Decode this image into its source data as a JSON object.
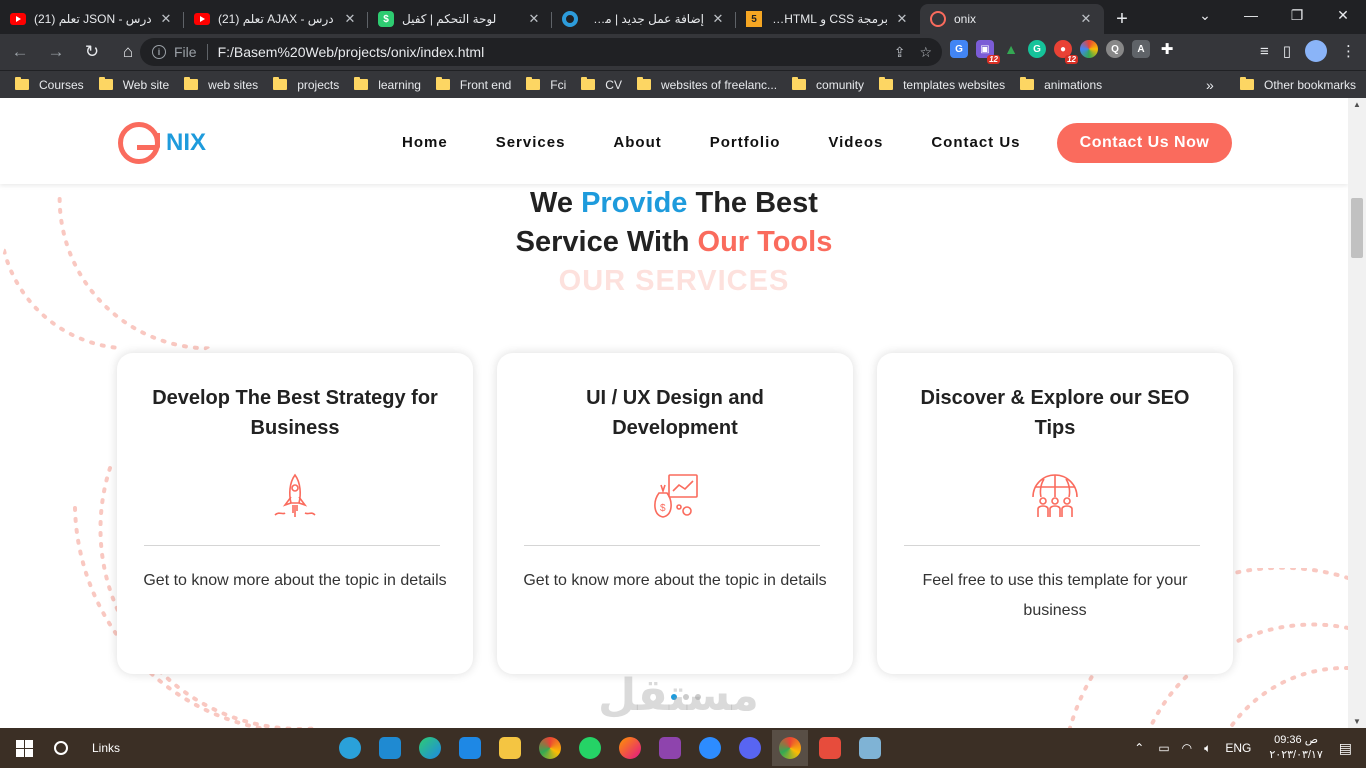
{
  "browser": {
    "tabs": [
      {
        "title": "درس - JSON تعلم (21)",
        "fav": "yt"
      },
      {
        "title": "درس - AJAX تعلم (21)",
        "fav": "yt"
      },
      {
        "title": "لوحة التحكم | كفيل",
        "fav": "kf"
      },
      {
        "title": "إضافة عمل جديد | مستقل",
        "fav": "ms"
      },
      {
        "title": "برمجة CSS و HTML | خمسات",
        "fav": "5"
      },
      {
        "title": "onix",
        "fav": "onix",
        "active": true
      }
    ],
    "new_tab": "+",
    "url_prefix": "File",
    "url": "F:/Basem%20Web/projects/onix/index.html",
    "ext_badges": [
      "12",
      "12"
    ],
    "bookmarks": [
      "Courses",
      "Web site",
      "web sites",
      "projects",
      "learning",
      "Front end",
      "Fci",
      "CV",
      "websites of freelanc...",
      "comunity",
      "templates websites",
      "animations"
    ],
    "bookmarks_more": "»",
    "other_bookmarks": "Other bookmarks"
  },
  "site": {
    "logo_text": "NIX",
    "nav": [
      "Home",
      "Services",
      "About",
      "Portfolio",
      "Videos",
      "Contact Us"
    ],
    "cta": "Contact Us Now",
    "heading": {
      "l1_a": "We ",
      "l1_b": "Provide",
      "l1_c": " The Best",
      "l2_a": "Service With ",
      "l2_b": "Our Tools"
    },
    "subheading": "OUR SERVICES",
    "cards": [
      {
        "title": "Develop The Best Strategy for Business",
        "icon": "rocket-icon",
        "text": "Get to know more about the topic in details"
      },
      {
        "title": "UI / UX Design and Development",
        "icon": "money-chart-icon",
        "text": "Get to know more about the topic in details"
      },
      {
        "title": "Discover & Explore our SEO Tips",
        "icon": "globe-team-icon",
        "text": "Feel free to use this template for your business"
      }
    ],
    "watermark": "مستقل"
  },
  "taskbar": {
    "search_label": "Links",
    "lang": "ENG",
    "time": "09:36 ص",
    "date": "٢٠٢٣/٠٣/١٧"
  },
  "colors": {
    "accent": "#fa6b5d",
    "blue": "#1e9bdc"
  }
}
